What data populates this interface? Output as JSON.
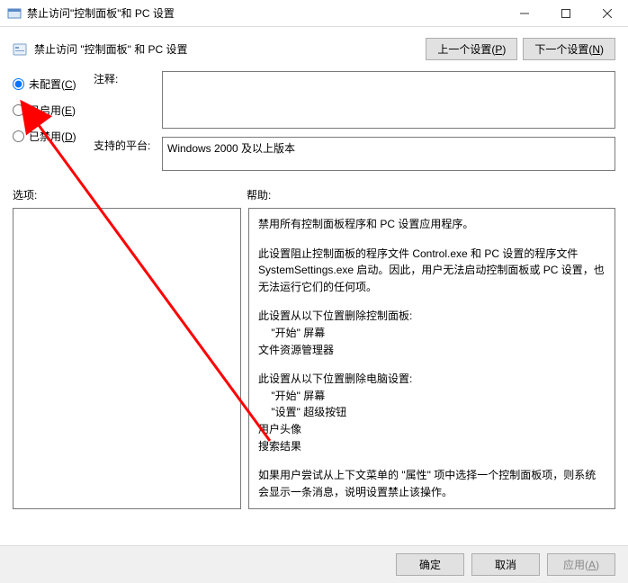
{
  "window": {
    "title": "禁止访问\"控制面板\"和 PC 设置"
  },
  "header": {
    "policy_name": "禁止访问 \"控制面板\" 和 PC 设置",
    "prev_btn": "上一个设置(",
    "prev_hot": "P",
    "prev_close": ")",
    "next_btn": "下一个设置(",
    "next_hot": "N",
    "next_close": ")"
  },
  "radios": {
    "not_configured": "未配置(",
    "not_configured_hot": "C",
    "enabled": "已启用(",
    "enabled_hot": "E",
    "disabled": "已禁用(",
    "disabled_hot": "D",
    "close": ")"
  },
  "labels": {
    "comment": "注释:",
    "platform": "支持的平台:",
    "options": "选项:",
    "help": "帮助:"
  },
  "platform_text": "Windows 2000 及以上版本",
  "help": {
    "p1": "禁用所有控制面板程序和 PC 设置应用程序。",
    "p2": "此设置阻止控制面板的程序文件 Control.exe 和 PC 设置的程序文件 SystemSettings.exe 启动。因此，用户无法启动控制面板或 PC 设置，也无法运行它们的任何项。",
    "p3": "此设置从以下位置删除控制面板:",
    "p3a": "\"开始\" 屏幕",
    "p3b": "文件资源管理器",
    "p4": "此设置从以下位置删除电脑设置:",
    "p4a": "\"开始\" 屏幕",
    "p4b": "\"设置\" 超级按钮",
    "p4c": "用户头像",
    "p4d": "搜索结果",
    "p5": "如果用户尝试从上下文菜单的 \"属性\" 项中选择一个控制面板项，则系统会显示一条消息，说明设置禁止该操作。"
  },
  "footer": {
    "ok": "确定",
    "cancel": "取消",
    "apply": "应用(",
    "apply_hot": "A",
    "apply_close": ")"
  }
}
